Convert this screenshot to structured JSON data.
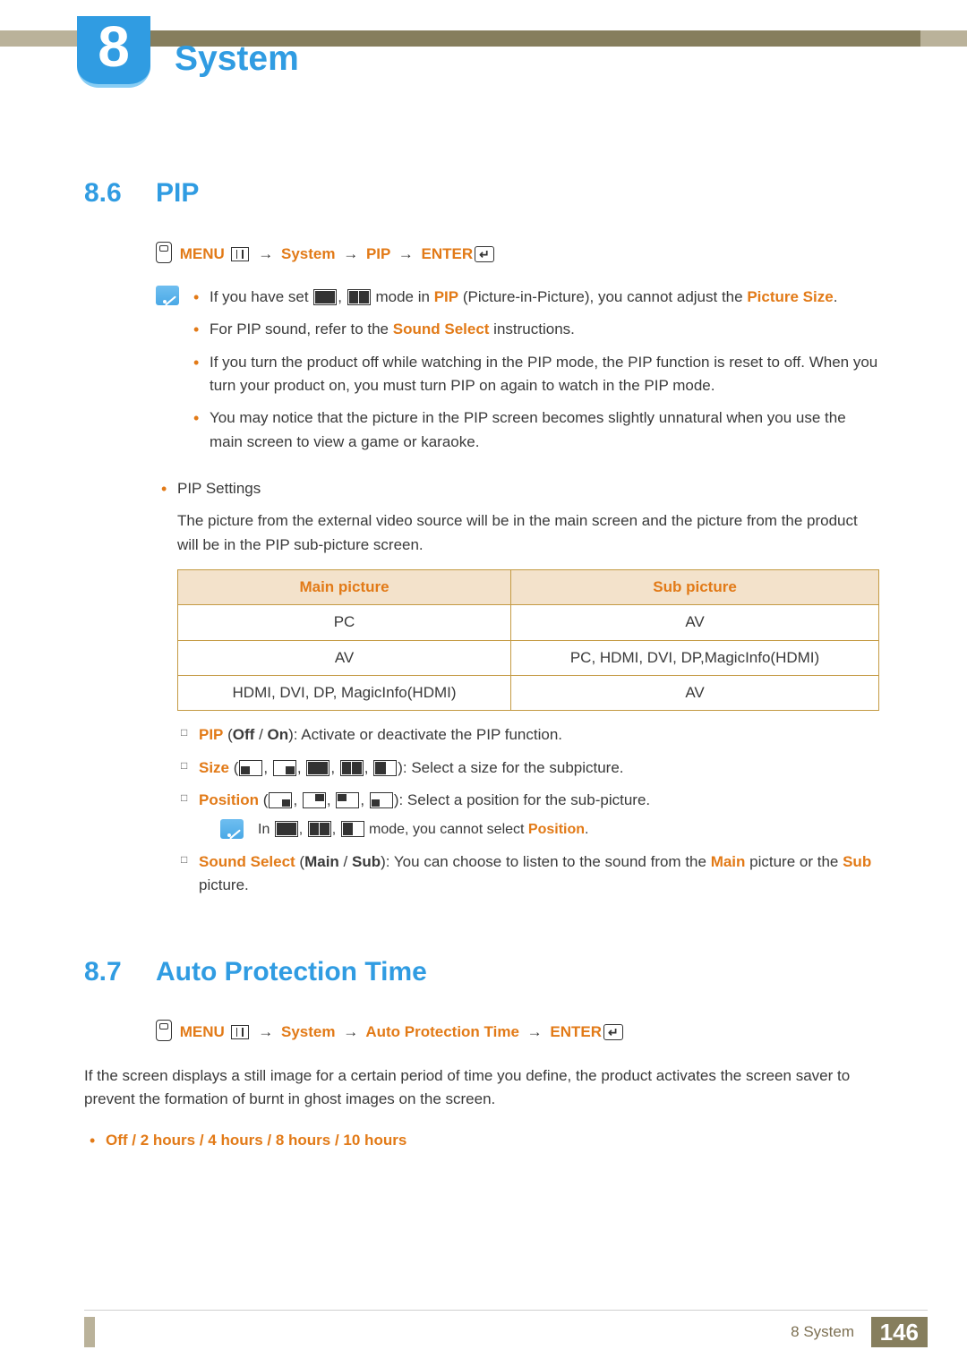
{
  "chapter": {
    "number": "8",
    "title": "System"
  },
  "section86": {
    "num": "8.6",
    "title": "PIP",
    "nav": {
      "menu": "MENU",
      "system": "System",
      "pip": "PIP",
      "enter": "ENTER"
    },
    "note1": {
      "b1_pre": "If you have set ",
      "b1_mid": " mode in ",
      "b1_pip": "PIP",
      "b1_mid2": " (Picture-in-Picture), you cannot adjust the ",
      "b1_ps": "Picture Size",
      "b2_pre": "For PIP sound, refer to the ",
      "b2_ss": "Sound Select",
      "b2_post": " instructions.",
      "b3": "If you turn the product off while watching in the PIP mode, the PIP function is reset to off. When you turn your product on, you must turn PIP on again to watch in the PIP mode.",
      "b4": "You may notice that the picture in the PIP screen becomes slightly unnatural when you use the main screen to view a game or karaoke."
    },
    "settings": {
      "label": "PIP Settings",
      "desc": "The picture from the external video source will be in the main screen and the picture from the product will be in the PIP sub-picture screen."
    },
    "table": {
      "h1": "Main picture",
      "h2": "Sub picture",
      "rows": [
        {
          "a": "PC",
          "b": "AV"
        },
        {
          "a": "AV",
          "b": "PC, HDMI, DVI, DP,MagicInfo(HDMI)"
        },
        {
          "a": "HDMI, DVI, DP, MagicInfo(HDMI)",
          "b": "AV"
        }
      ]
    },
    "opts": {
      "pip_l": "PIP",
      "pip_off": "Off",
      "pip_on": "On",
      "pip_d": ": Activate or deactivate the PIP function.",
      "size_l": "Size",
      "size_d": "): Select a size for the subpicture.",
      "pos_l": "Position",
      "pos_d": "): Select a position for the sub-picture.",
      "ss_l": "Sound Select",
      "ss_main": "Main",
      "ss_sub": "Sub",
      "ss_d1": ": You can choose to listen to the sound from the ",
      "ss_d2": " picture or the ",
      "ss_d3": " picture."
    },
    "innerNote": {
      "pre": "In ",
      "mid": " mode, you cannot select ",
      "pos": "Position",
      "end": "."
    }
  },
  "section87": {
    "num": "8.7",
    "title": "Auto Protection Time",
    "nav": {
      "menu": "MENU",
      "system": "System",
      "apt": "Auto Protection Time",
      "enter": "ENTER"
    },
    "desc": "If the screen displays a still image for a certain period of time you define, the product activates the screen saver to prevent the formation of burnt in ghost images on the screen.",
    "opts": "Off / 2 hours / 4 hours / 8 hours / 10 hours"
  },
  "footer": {
    "sec": "8 System",
    "page": "146"
  }
}
